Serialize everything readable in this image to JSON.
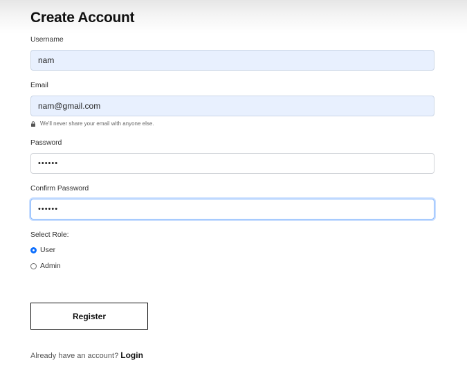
{
  "form": {
    "title": "Create Account",
    "username": {
      "label": "Username",
      "value": "nam"
    },
    "email": {
      "label": "Email",
      "value": "nam@gmail.com",
      "help_text": "We'll never share your email with anyone else."
    },
    "password": {
      "label": "Password",
      "value": "••••••"
    },
    "confirm_password": {
      "label": "Confirm Password",
      "value": "••••••"
    },
    "role": {
      "label": "Select Role:",
      "options": [
        {
          "label": "User",
          "selected": true
        },
        {
          "label": "Admin",
          "selected": false
        }
      ]
    },
    "register_label": "Register",
    "footer": {
      "prompt": "Already have an account?",
      "login_label": "Login"
    }
  },
  "colors": {
    "autofill_bg": "#e8f0fe",
    "focus_border": "#86b7fe",
    "radio_checked": "#0d6efd"
  }
}
